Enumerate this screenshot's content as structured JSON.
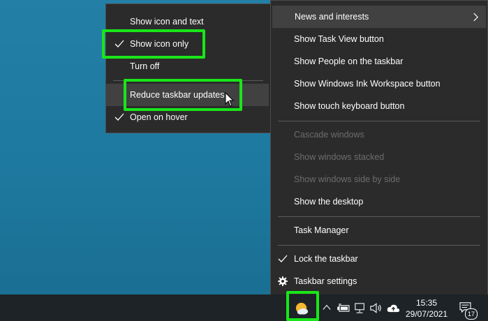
{
  "submenu": {
    "items": [
      {
        "label": "Show icon and text",
        "checked": false
      },
      {
        "label": "Show icon only",
        "checked": true
      },
      {
        "label": "Turn off",
        "checked": false
      },
      {
        "label": "Reduce taskbar updates",
        "checked": false,
        "hovered": true
      },
      {
        "label": "Open on hover",
        "checked": true
      }
    ]
  },
  "main_menu": {
    "items": [
      {
        "label": "News and interests",
        "has_submenu": true,
        "enabled": true
      },
      {
        "label": "Show Task View button",
        "enabled": true
      },
      {
        "label": "Show People on the taskbar",
        "enabled": true
      },
      {
        "label": "Show Windows Ink Workspace button",
        "enabled": true
      },
      {
        "label": "Show touch keyboard button",
        "enabled": true
      },
      {
        "label": "Cascade windows",
        "enabled": false
      },
      {
        "label": "Show windows stacked",
        "enabled": false
      },
      {
        "label": "Show windows side by side",
        "enabled": false
      },
      {
        "label": "Show the desktop",
        "enabled": true
      },
      {
        "label": "Task Manager",
        "enabled": true
      },
      {
        "label": "Lock the taskbar",
        "enabled": true,
        "checked": true
      },
      {
        "label": "Taskbar settings",
        "enabled": true,
        "icon": "gear-icon"
      }
    ]
  },
  "taskbar": {
    "time": "15:35",
    "date": "29/07/2021",
    "notification_count": "17",
    "tray_icons": [
      "weather-icon",
      "chevron-up-icon",
      "battery-icon",
      "network-icon",
      "volume-icon",
      "cloud-upload-icon",
      "notification-icon"
    ]
  },
  "colors": {
    "highlight": "#19e619",
    "menu_bg": "#2b2b2b",
    "desktop": "#1f7ea2",
    "taskbar": "#1d2327"
  }
}
